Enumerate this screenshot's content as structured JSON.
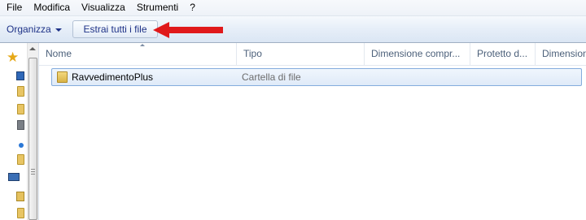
{
  "menu": {
    "items": [
      {
        "label": "File"
      },
      {
        "label": "Modifica"
      },
      {
        "label": "Visualizza"
      },
      {
        "label": "Strumenti"
      },
      {
        "label": "?"
      }
    ]
  },
  "toolbar": {
    "organize_label": "Organizza",
    "extract_all_label": "Estrai tutti i file"
  },
  "columns": [
    {
      "label": "Nome"
    },
    {
      "label": "Tipo"
    },
    {
      "label": "Dimensione compr..."
    },
    {
      "label": "Protetto d..."
    },
    {
      "label": "Dimension"
    }
  ],
  "files": [
    {
      "name": "RavvedimentoPlus",
      "type": "Cartella di file"
    }
  ],
  "colors": {
    "annotation_arrow": "#e0191b",
    "selection_border": "#84acdd"
  },
  "icons": {
    "favorites": "star-icon",
    "row": "folder-icon",
    "annotation": "red-arrow-icon"
  }
}
